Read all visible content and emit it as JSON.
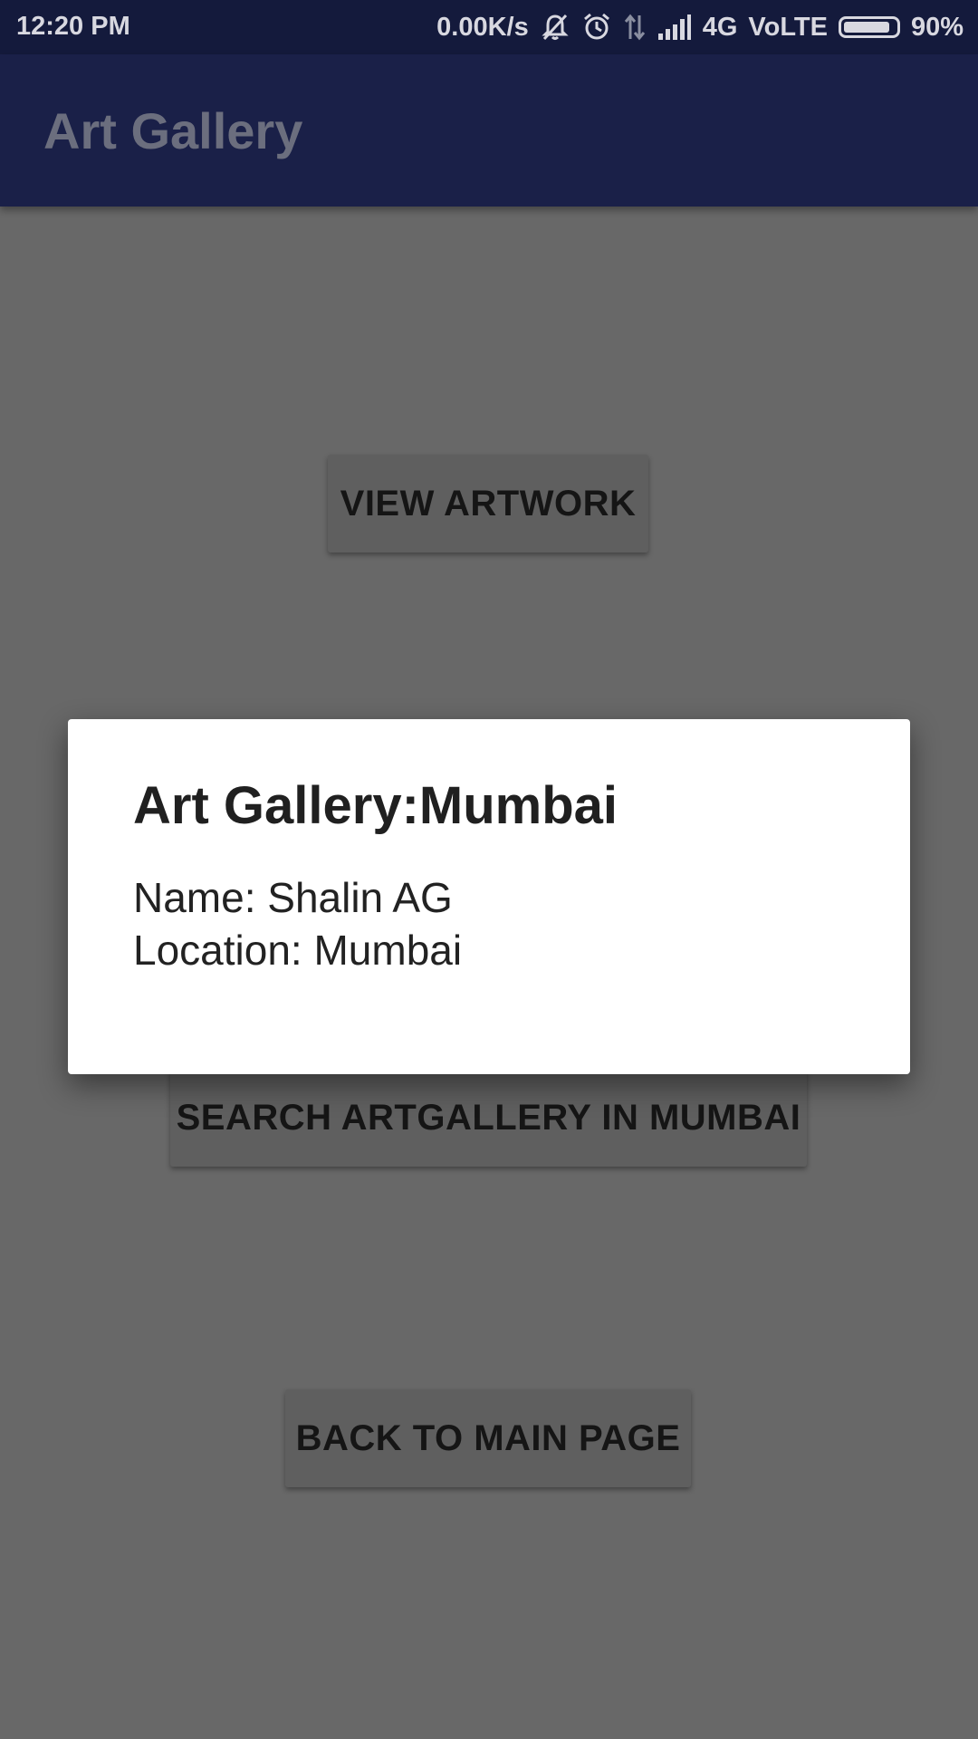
{
  "status_bar": {
    "time": "12:20 PM",
    "net_speed": "0.00K/s",
    "network": "4G",
    "volte": "VoLTE",
    "battery_percent": "90%",
    "battery_level": 0.9,
    "icons": [
      "mute-icon",
      "alarm-icon",
      "data-arrows-icon",
      "signal-icon"
    ]
  },
  "app_bar": {
    "title": "Art Gallery"
  },
  "buttons": {
    "view_artwork": "VIEW ARTWORK",
    "search_artgallery": "SEARCH ARTGALLERY IN MUMBAI",
    "back_to_main": "BACK TO MAIN PAGE"
  },
  "dialog": {
    "title": "Art Gallery:Mumbai",
    "name_line": "Name: Shalin AG",
    "location_line": "Location: Mumbai"
  },
  "colors": {
    "status_bar": "#141a3c",
    "app_bar": "#1a2048",
    "scrim_background": "#686868",
    "button": "#5f5f5f",
    "dialog": "#ffffff"
  }
}
